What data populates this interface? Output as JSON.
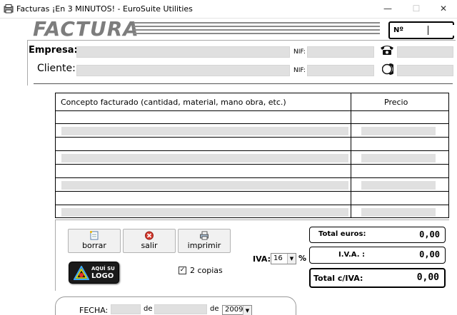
{
  "window": {
    "title": "Facturas  ¡En 3 MINUTOS! - EuroSuite Utilities",
    "minimize_glyph": "—",
    "maximize_glyph": "☐",
    "close_glyph": "✕"
  },
  "header": {
    "title": "FACTURA",
    "number_label": "Nº",
    "number_value": ""
  },
  "client_section": {
    "empresa_label": "Empresa:",
    "cliente_label": "Cliente:",
    "nif_label": "NIF:",
    "empresa_name": "",
    "empresa_nif": "",
    "empresa_phone": "",
    "cliente_name": "",
    "cliente_nif": "",
    "cliente_phone": "",
    "phone_icon": "telephone-icon",
    "mobile_icon": "mobile-phone-icon"
  },
  "items": {
    "concept_header": "Concepto facturado (cantidad, material, mano obra, etc.)",
    "price_header": "Precio",
    "rows": [
      {
        "concept": "",
        "price": "",
        "editable": false
      },
      {
        "concept": "",
        "price": "",
        "editable": true
      },
      {
        "concept": "",
        "price": "",
        "editable": false
      },
      {
        "concept": "",
        "price": "",
        "editable": true
      },
      {
        "concept": "",
        "price": "",
        "editable": false
      },
      {
        "concept": "",
        "price": "",
        "editable": true
      },
      {
        "concept": "",
        "price": "",
        "editable": false
      },
      {
        "concept": "",
        "price": "",
        "editable": true
      }
    ]
  },
  "toolbar": {
    "borrar_label": "borrar",
    "salir_label": "salir",
    "imprimir_label": "imprimir",
    "borrar_icon": "new-document-icon",
    "salir_icon": "exit-icon",
    "imprimir_icon": "printer-icon"
  },
  "logo": {
    "line1": "AQUÍ SU",
    "line2": "LOGO"
  },
  "copies": {
    "checked": true,
    "check_glyph": "✓",
    "label": "2 copias"
  },
  "iva": {
    "label": "IVA:",
    "rate": "16",
    "percent_sign": "%",
    "arrow_glyph": "▼"
  },
  "totals": {
    "total_euros_label": "Total euros:",
    "total_euros_value": "0,00",
    "iva_label": "I.V.A. :",
    "iva_value": "0,00",
    "total_con_iva_label": "Total c/IVA:",
    "total_con_iva_value": "0,00"
  },
  "fecha": {
    "label": "FECHA:",
    "de": "de",
    "day": "",
    "month": "",
    "year": "2009"
  },
  "colors": {
    "title_gray": "#7d7d7d",
    "field_gray": "#e0e0e0",
    "border_black": "#000000"
  }
}
